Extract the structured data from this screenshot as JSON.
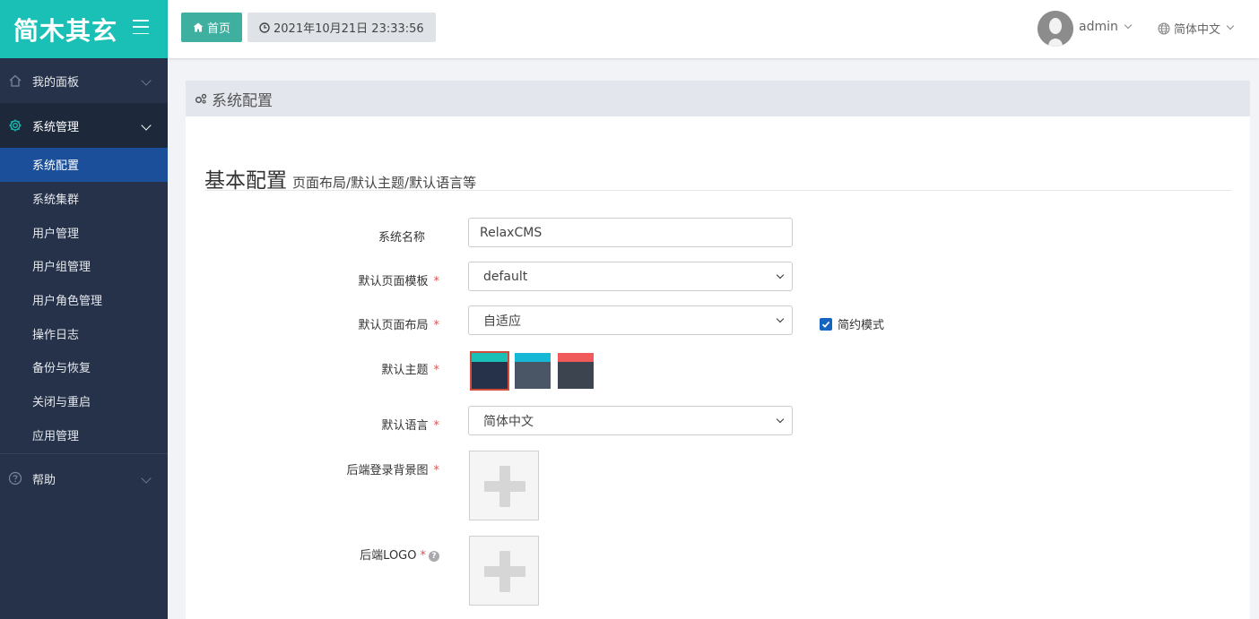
{
  "brand": {
    "title": "简木其玄"
  },
  "sidebar": {
    "groups": [
      {
        "label": "我的面板",
        "icon": "home-icon"
      },
      {
        "label": "系统管理",
        "icon": "gear-icon"
      },
      {
        "label": "帮助",
        "icon": "help-circle-icon"
      }
    ],
    "sub_items": [
      {
        "label": "系统配置"
      },
      {
        "label": "系统集群"
      },
      {
        "label": "用户管理"
      },
      {
        "label": "用户组管理"
      },
      {
        "label": "用户角色管理"
      },
      {
        "label": "操作日志"
      },
      {
        "label": "备份与恢复"
      },
      {
        "label": "关闭与重启"
      },
      {
        "label": "应用管理"
      }
    ]
  },
  "header": {
    "home_label": "首页",
    "datetime": "2021年10月21日 23:33:56",
    "username": "admin",
    "language": "简体中文"
  },
  "panel": {
    "title": "系统配置",
    "section_title": "基本配置",
    "section_subtitle": "页面布局/默认主题/默认语言等"
  },
  "form": {
    "system_name_label": "系统名称",
    "system_name_value": "RelaxCMS",
    "template_label": "默认页面模板",
    "template_value": "default",
    "layout_label": "默认页面布局",
    "layout_value": "自适应",
    "simple_mode_label": "简约模式",
    "simple_mode_checked": true,
    "theme_label": "默认主题",
    "themes": [
      {
        "top": "#1ac0b6",
        "bottom": "#25324a",
        "selected": true
      },
      {
        "top": "#17b7d6",
        "bottom": "#4a5565",
        "selected": false
      },
      {
        "top": "#f15a5a",
        "bottom": "#3c4450",
        "selected": false
      }
    ],
    "language_label": "默认语言",
    "language_value": "简体中文",
    "login_bg_label": "后端登录背景图",
    "logo_label": "后端LOGO",
    "required_mark": "*",
    "help_mark": "?"
  },
  "colors": {
    "accent": "#1ac0b6",
    "sidebar": "#25324a",
    "active_item": "#1b4f9a",
    "required": "#d9534f"
  }
}
